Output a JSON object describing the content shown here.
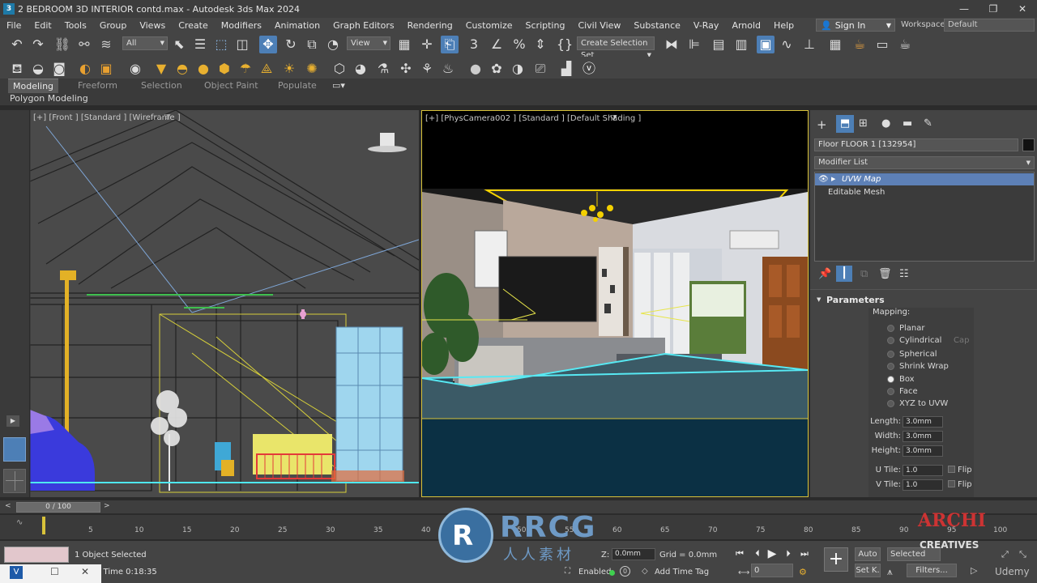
{
  "window": {
    "title": "2 BEDROOM 3D  INTERIOR contd.max - Autodesk 3ds Max 2024",
    "minimize": "—",
    "maximize": "❐",
    "close": "✕"
  },
  "menu": [
    "File",
    "Edit",
    "Tools",
    "Group",
    "Views",
    "Create",
    "Modifiers",
    "Animation",
    "Graph Editors",
    "Rendering",
    "Customize",
    "Scripting",
    "Civil View",
    "Substance",
    "V-Ray",
    "Arnold",
    "Help"
  ],
  "account": {
    "sign_in": "Sign In",
    "workspaces_label": "Workspaces:",
    "workspace": "Default"
  },
  "toolbar": {
    "selection_filter": "All",
    "reference_coord": "View",
    "create_selection_set": "Create Selection Set"
  },
  "ribbon": {
    "tabs": [
      "Modeling",
      "Freeform",
      "Selection",
      "Object Paint",
      "Populate"
    ],
    "panel": "Polygon Modeling"
  },
  "viewports": {
    "front_label": "[+] [Front ] [Standard ] [Wireframe ]",
    "camera_label": "[+] [PhysCamera002 ] [Standard ] [Default Shading ]"
  },
  "command_panel": {
    "object_name": "Floor FLOOR 1 [132954]",
    "object_color": "#111111",
    "modifier_list": "Modifier List",
    "stack": [
      "UVW Map",
      "Editable Mesh"
    ],
    "parameters_title": "Parameters",
    "mapping_label": "Mapping:",
    "mapping_options": [
      "Planar",
      "Cylindrical",
      "Spherical",
      "Shrink Wrap",
      "Box",
      "Face",
      "XYZ to UVW"
    ],
    "mapping_selected": "Box",
    "cap_label": "Cap",
    "length_label": "Length:",
    "length_value": "3.0mm",
    "width_label": "Width:",
    "width_value": "3.0mm",
    "height_label": "Height:",
    "height_value": "3.0mm",
    "utile_label": "U Tile:",
    "utile_value": "1.0",
    "vtile_label": "V Tile:",
    "vtile_value": "1.0",
    "flip_label": "Flip"
  },
  "timeline": {
    "frame_display": "0 / 100",
    "ticks": [
      "5",
      "10",
      "15",
      "20",
      "25",
      "30",
      "35",
      "40",
      "45",
      "50",
      "55",
      "60",
      "65",
      "70",
      "75",
      "80",
      "85",
      "90",
      "95",
      "100"
    ]
  },
  "status": {
    "selection": "1 Object Selected",
    "render_time": "g Time  0:18:35",
    "z_label": "Z:",
    "z_value": "0.0mm",
    "grid": "Grid = 0.0mm",
    "enabled_label": "Enabled:",
    "add_time_tag": "Add Time Tag",
    "auto": "Auto",
    "selected": "Selected",
    "set_key": "Set K.",
    "filters": "Filters...",
    "frame_field": "0"
  },
  "watermarks": {
    "rrcg": "RRCG",
    "rrcg_sub": "人人素材",
    "archi_top": "ARCHI",
    "archi_bottom": "CREATIVES",
    "udemy": "Udemy"
  },
  "colors": {
    "accent": "#4d7fb6",
    "selection_highlight": "#5d80b6",
    "camera_border": "#d8c23a"
  }
}
